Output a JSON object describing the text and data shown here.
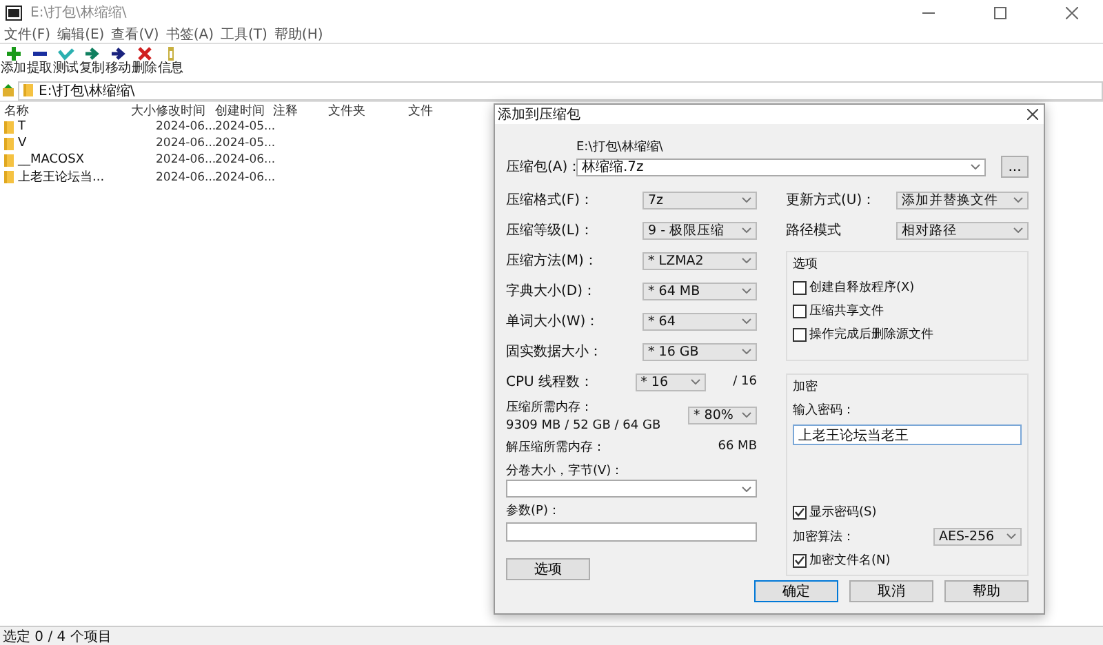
{
  "window": {
    "title": "E:\\打包\\林缩缩\\"
  },
  "menu": [
    "文件(F)",
    "编辑(E)",
    "查看(V)",
    "书签(A)",
    "工具(T)",
    "帮助(H)"
  ],
  "toolbar": [
    {
      "label": "添加",
      "kind": "add"
    },
    {
      "label": "提取",
      "kind": "extract"
    },
    {
      "label": "测试",
      "kind": "test"
    },
    {
      "label": "复制",
      "kind": "copy"
    },
    {
      "label": "移动",
      "kind": "move"
    },
    {
      "label": "删除",
      "kind": "delete"
    },
    {
      "label": "信息",
      "kind": "info"
    }
  ],
  "address": "E:\\打包\\林缩缩\\",
  "columns": [
    "名称",
    "大小",
    "修改时间",
    "创建时间",
    "注释",
    "文件夹",
    "文件"
  ],
  "rows": [
    {
      "name": "T",
      "modified": "2024-06...",
      "created": "2024-05..."
    },
    {
      "name": "V",
      "modified": "2024-06...",
      "created": "2024-05..."
    },
    {
      "name": "__MACOSX",
      "modified": "2024-06...",
      "created": "2024-06..."
    },
    {
      "name": "上老王论坛当...",
      "modified": "2024-06...",
      "created": "2024-06..."
    }
  ],
  "status_bar": "选定 0 / 4 个项目",
  "dialog": {
    "title": "添加到压缩包",
    "archive_label": "压缩包(A)：",
    "archive_path": "E:\\打包\\林缩缩\\",
    "archive_name": "林缩缩.7z",
    "browse_button": "...",
    "left_rows": [
      {
        "kind": "combo",
        "label": "压缩格式(F)：",
        "value": "7z"
      },
      {
        "kind": "combo",
        "label": "压缩等级(L)：",
        "value": "9 - 极限压缩"
      },
      {
        "kind": "combo",
        "label": "压缩方法(M)：",
        "value": "* LZMA2"
      },
      {
        "kind": "combo",
        "label": "字典大小(D)：",
        "value": "* 64 MB"
      },
      {
        "kind": "combo",
        "label": "单词大小(W)：",
        "value": "* 64"
      },
      {
        "kind": "combo",
        "label": "固实数据大小：",
        "value": "* 16 GB"
      },
      {
        "kind": "cpu",
        "label": "CPU 线程数：",
        "value": "* 16",
        "suffix": "/ 16"
      },
      {
        "kind": "memory",
        "label": "压缩所需内存：",
        "detail": "9309 MB / 52 GB / 64 GB",
        "value": "* 80%"
      },
      {
        "kind": "info",
        "label": "解压缩所需内存：",
        "value": "66 MB"
      }
    ],
    "volume_label": "分卷大小，字节(V)：",
    "params_label": "参数(P)：",
    "options_button": "选项",
    "right_rows": [
      {
        "label": "更新方式(U)：",
        "value": "添加并替换文件"
      },
      {
        "label": "路径模式",
        "value": "相对路径"
      }
    ],
    "options_group": {
      "title": "选项",
      "checkboxes": [
        {
          "label": "创建自释放程序(X)",
          "checked": false
        },
        {
          "label": "压缩共享文件",
          "checked": false
        },
        {
          "label": "操作完成后删除源文件",
          "checked": false
        }
      ]
    },
    "encryption_group": {
      "title": "加密",
      "password_label": "输入密码：",
      "password": "上老王论坛当老王",
      "show_password": {
        "label": "显示密码(S)",
        "checked": true
      },
      "method_label": "加密算法：",
      "method": "AES-256",
      "encrypt_names": {
        "label": "加密文件名(N)",
        "checked": true
      }
    },
    "buttons": [
      {
        "label": "确定",
        "selected": true
      },
      {
        "label": "取消",
        "selected": false
      },
      {
        "label": "帮助",
        "selected": false
      }
    ]
  }
}
